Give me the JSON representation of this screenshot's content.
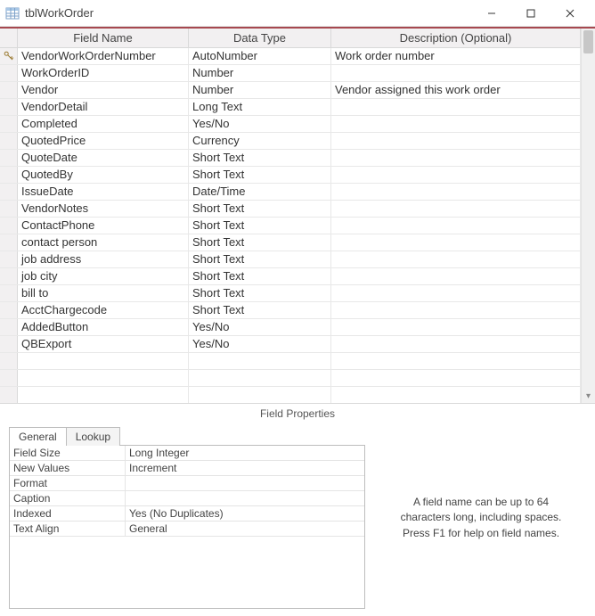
{
  "window": {
    "title": "tblWorkOrder"
  },
  "grid": {
    "headers": {
      "field": "Field Name",
      "type": "Data Type",
      "desc": "Description (Optional)"
    },
    "rows": [
      {
        "pk": true,
        "field": "VendorWorkOrderNumber",
        "type": "AutoNumber",
        "desc": "Work order number"
      },
      {
        "pk": false,
        "field": "WorkOrderID",
        "type": "Number",
        "desc": ""
      },
      {
        "pk": false,
        "field": "Vendor",
        "type": "Number",
        "desc": "Vendor assigned this work order"
      },
      {
        "pk": false,
        "field": "VendorDetail",
        "type": "Long Text",
        "desc": ""
      },
      {
        "pk": false,
        "field": "Completed",
        "type": "Yes/No",
        "desc": ""
      },
      {
        "pk": false,
        "field": "QuotedPrice",
        "type": "Currency",
        "desc": ""
      },
      {
        "pk": false,
        "field": "QuoteDate",
        "type": "Short Text",
        "desc": ""
      },
      {
        "pk": false,
        "field": "QuotedBy",
        "type": "Short Text",
        "desc": ""
      },
      {
        "pk": false,
        "field": "IssueDate",
        "type": "Date/Time",
        "desc": ""
      },
      {
        "pk": false,
        "field": "VendorNotes",
        "type": "Short Text",
        "desc": ""
      },
      {
        "pk": false,
        "field": "ContactPhone",
        "type": "Short Text",
        "desc": ""
      },
      {
        "pk": false,
        "field": "contact person",
        "type": "Short Text",
        "desc": ""
      },
      {
        "pk": false,
        "field": "job address",
        "type": "Short Text",
        "desc": ""
      },
      {
        "pk": false,
        "field": "job city",
        "type": "Short Text",
        "desc": ""
      },
      {
        "pk": false,
        "field": "bill to",
        "type": "Short Text",
        "desc": ""
      },
      {
        "pk": false,
        "field": "AcctChargecode",
        "type": "Short Text",
        "desc": ""
      },
      {
        "pk": false,
        "field": "AddedButton",
        "type": "Yes/No",
        "desc": ""
      },
      {
        "pk": false,
        "field": "QBExport",
        "type": "Yes/No",
        "desc": ""
      },
      {
        "pk": false,
        "field": "",
        "type": "",
        "desc": ""
      }
    ]
  },
  "fieldPropsLabel": "Field Properties",
  "tabs": {
    "general": "General",
    "lookup": "Lookup"
  },
  "props": [
    {
      "label": "Field Size",
      "value": "Long Integer"
    },
    {
      "label": "New Values",
      "value": "Increment"
    },
    {
      "label": "Format",
      "value": ""
    },
    {
      "label": "Caption",
      "value": ""
    },
    {
      "label": "Indexed",
      "value": "Yes (No Duplicates)"
    },
    {
      "label": "Text Align",
      "value": "General"
    }
  ],
  "help": "A field name can be up to 64 characters long, including spaces. Press F1 for help on field names."
}
